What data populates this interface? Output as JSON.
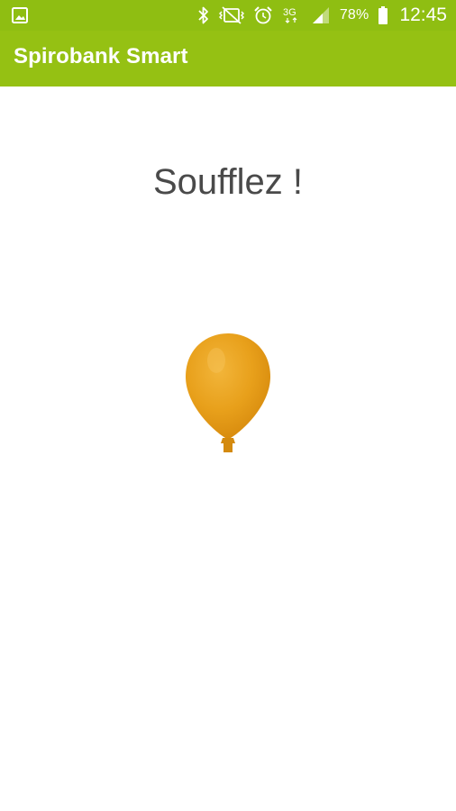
{
  "status_bar": {
    "icons": [
      "image-notification-icon",
      "bluetooth-icon",
      "vibrate-icon",
      "alarm-icon",
      "network-3g-icon",
      "signal-icon",
      "battery-icon"
    ],
    "network_type": "3G",
    "battery_percent": "78%",
    "time": "12:45"
  },
  "app_bar": {
    "title": "Spirobank Smart"
  },
  "main": {
    "prompt": "Soufflez !",
    "balloon_icon": "balloon-icon"
  },
  "colors": {
    "status_bar": "#8fbe12",
    "app_bar": "#95c113",
    "balloon": "#e8a01b",
    "prompt_text": "#4a4a4a"
  }
}
